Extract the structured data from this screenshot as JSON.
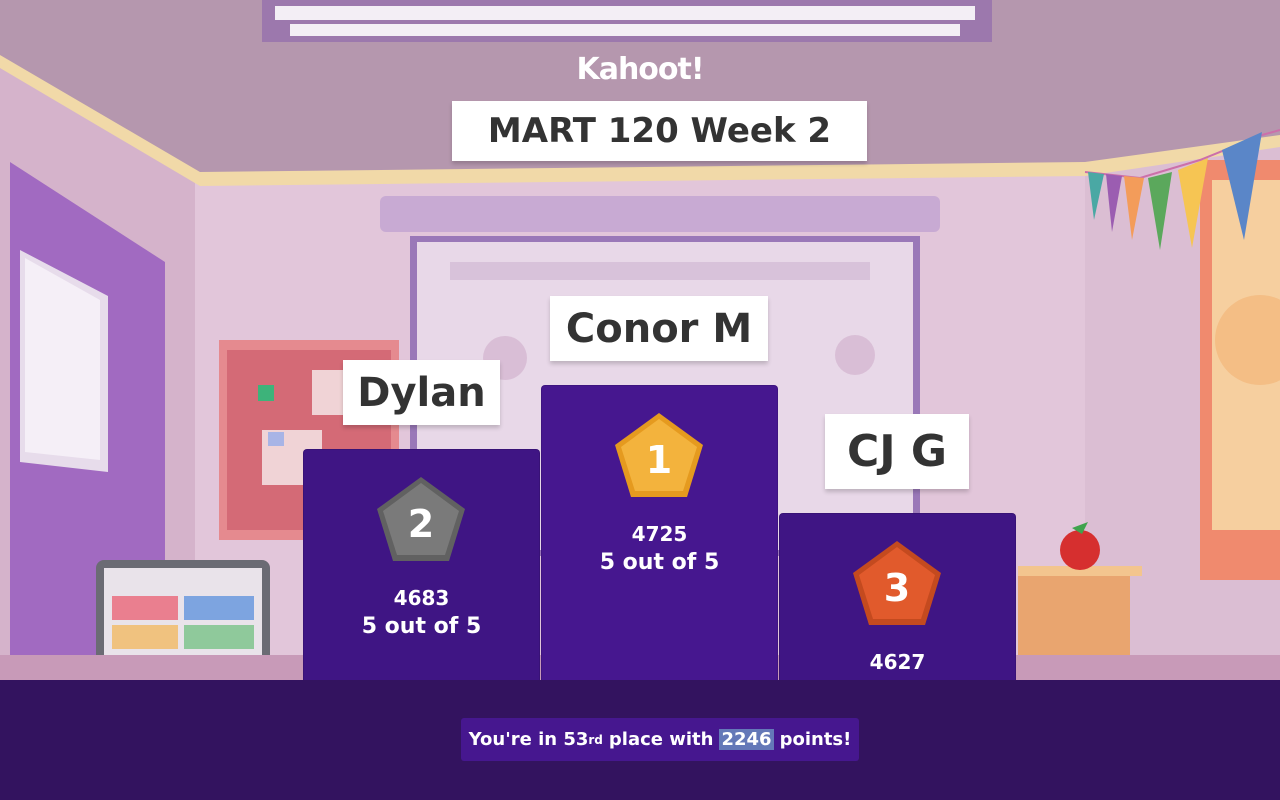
{
  "header": {
    "logo_text": "Kahoot!",
    "title": "MART 120 Week 2"
  },
  "podium": [
    {
      "rank": "1",
      "name": "Conor M",
      "points": "4725",
      "correct": "5 out of 5",
      "medal_color": "#f3b33d"
    },
    {
      "rank": "2",
      "name": "Dylan",
      "points": "4683",
      "correct": "5 out of 5",
      "medal_color": "#7a7a7a"
    },
    {
      "rank": "3",
      "name": "CJ G",
      "points": "4627",
      "medal_color": "#e15a2c"
    }
  ],
  "footer": {
    "rank_prefix": "You're in ",
    "rank_number": "53",
    "rank_suffix": "rd",
    "middle_text": "place with",
    "points": "2246",
    "points_label": "points!"
  },
  "colors": {
    "pillar": "#46178f",
    "bottom_bar": "#33135f",
    "background": "#d7b9cf"
  }
}
